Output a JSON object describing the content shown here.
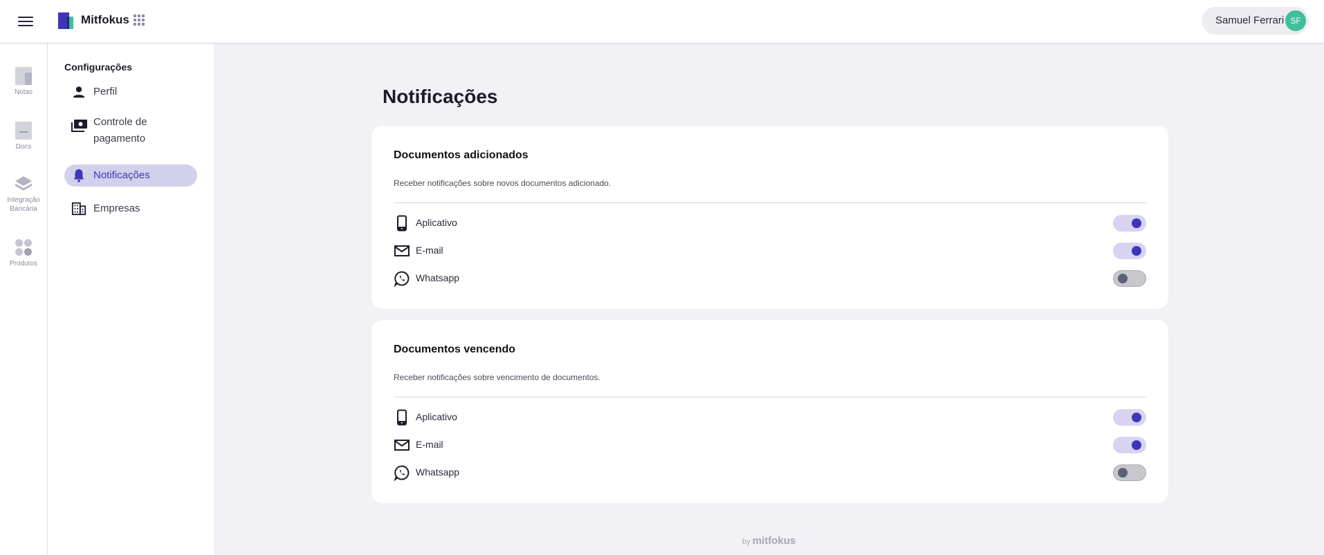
{
  "app": {
    "name": "Mitfokus"
  },
  "user": {
    "name": "Samuel Ferrari",
    "initials": "SF"
  },
  "rail": [
    {
      "label": "Notas",
      "icon": "notes-icon"
    },
    {
      "label": "Docs",
      "icon": "docs-icon"
    },
    {
      "label": "Integração Bancária",
      "icon": "layers-icon"
    },
    {
      "label": "Produtos",
      "icon": "products-icon"
    }
  ],
  "settings_nav": {
    "title": "Configurações",
    "items": [
      {
        "label": "Perfil",
        "icon": "person-icon",
        "active": false
      },
      {
        "label": "Controle de pagamento",
        "icon": "payment-icon",
        "active": false
      },
      {
        "label": "Notificações",
        "icon": "bell-icon",
        "active": true
      },
      {
        "label": "Empresas",
        "icon": "building-icon",
        "active": false
      }
    ]
  },
  "page": {
    "title": "Notificações"
  },
  "sections": [
    {
      "title": "Documentos adicionados",
      "description": "Receber notificações sobre novos documentos adicionado.",
      "channels": [
        {
          "label": "Aplicativo",
          "icon": "phone-icon",
          "enabled": true
        },
        {
          "label": "E-mail",
          "icon": "mail-icon",
          "enabled": true
        },
        {
          "label": "Whatsapp",
          "icon": "whatsapp-icon",
          "enabled": false
        }
      ]
    },
    {
      "title": "Documentos vencendo",
      "description": "Receber notificações sobre vencimento de documentos.",
      "channels": [
        {
          "label": "Aplicativo",
          "icon": "phone-icon",
          "enabled": true
        },
        {
          "label": "E-mail",
          "icon": "mail-icon",
          "enabled": true
        },
        {
          "label": "Whatsapp",
          "icon": "whatsapp-icon",
          "enabled": false
        }
      ]
    }
  ],
  "footer": {
    "by": "by",
    "brand": "mitfokus"
  },
  "colors": {
    "accent": "#4035b8",
    "accent_soft": "#d7d3f1",
    "avatar": "#3fbf9a",
    "background": "#f1f1f6"
  }
}
